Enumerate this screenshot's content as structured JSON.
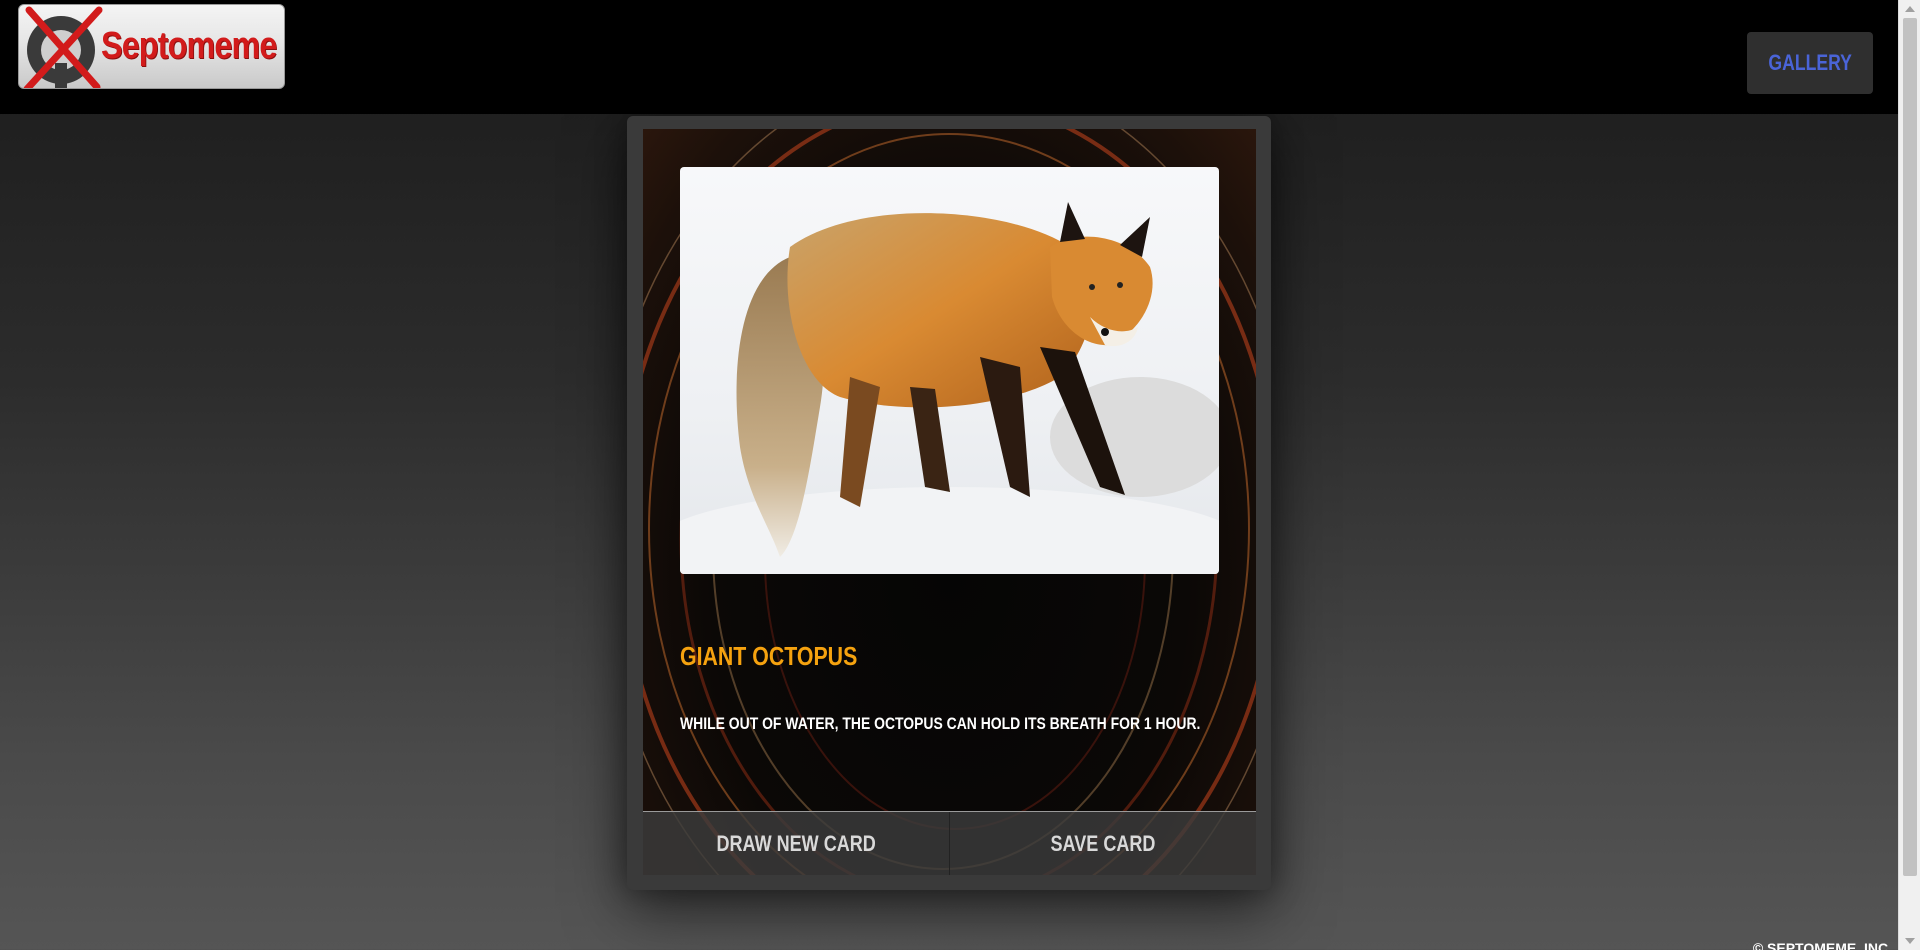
{
  "header": {
    "logo_text": "Septomeme",
    "gallery_label": "GALLERY"
  },
  "card": {
    "title": "GIANT OCTOPUS",
    "description": "WHILE OUT OF WATER, THE OCTOPUS CAN HOLD ITS BREATH FOR 1 HOUR.",
    "image_subject": "red fox in snow",
    "draw_label": "DRAW NEW CARD",
    "save_label": "SAVE CARD"
  },
  "footer": {
    "copyright": "© SEPTOMEME, INC."
  },
  "colors": {
    "title_accent": "#f5a20f",
    "gallery_text": "#4a64d8",
    "logo_red": "#d21b1b"
  }
}
